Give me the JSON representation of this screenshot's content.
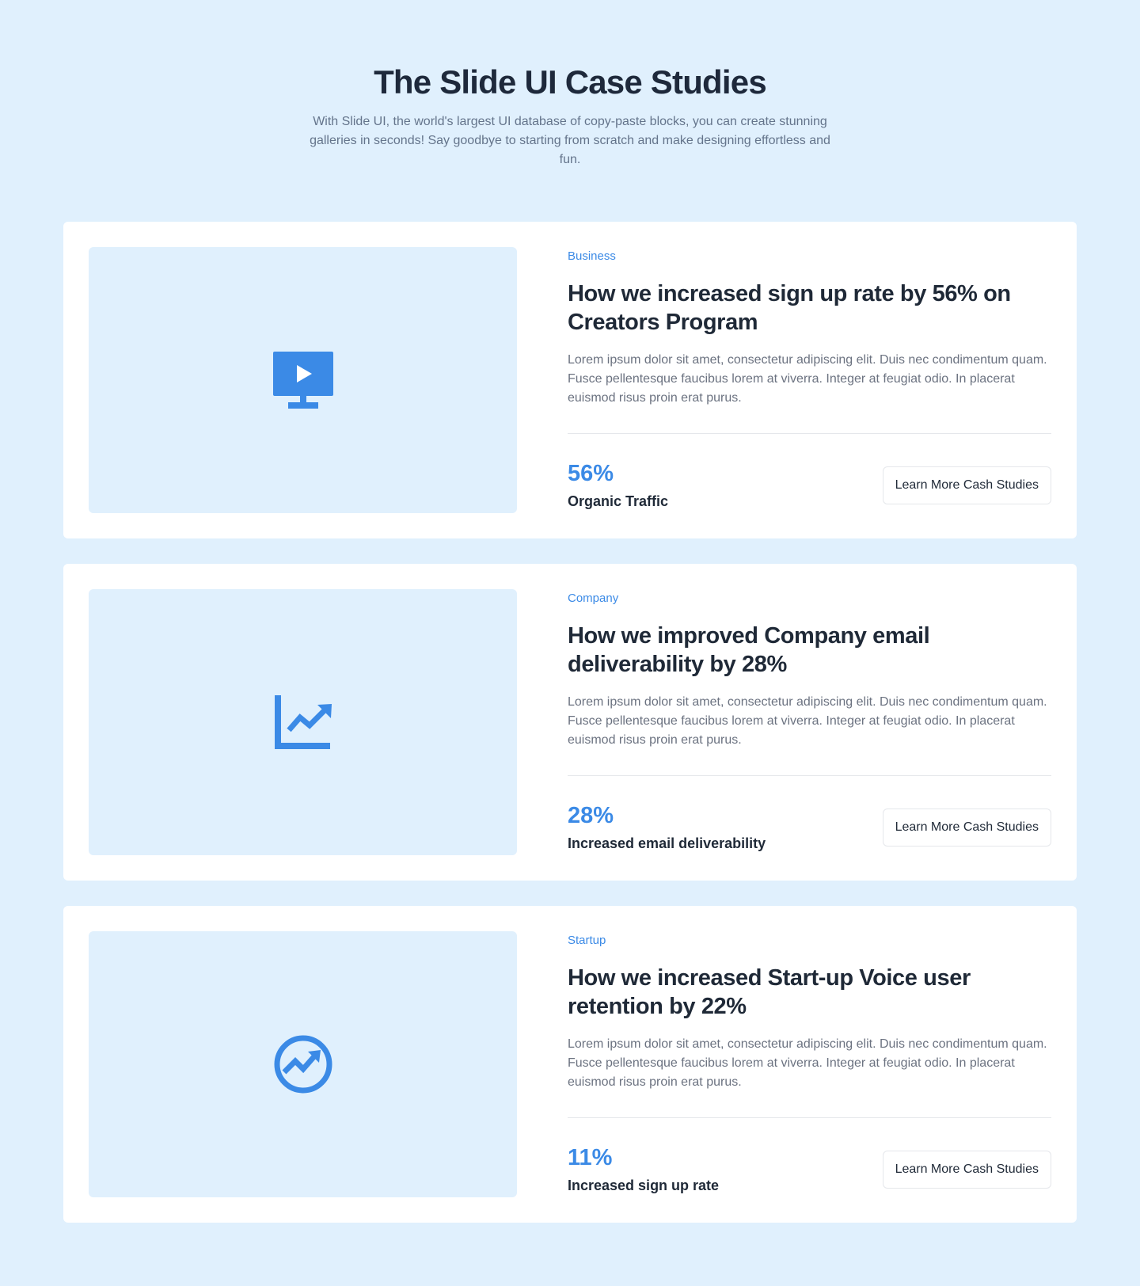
{
  "header": {
    "title": "The Slide UI Case Studies",
    "subtitle": "With Slide UI, the world's largest UI database of copy-paste blocks, you can create stunning galleries in seconds! Say goodbye to starting from scratch and make designing effortless and fun."
  },
  "colors": {
    "page_background": "#e0f0fd",
    "accent": "#3b8ae6",
    "card_background": "#ffffff"
  },
  "cards": [
    {
      "icon": "monitor-play-icon",
      "category": "Business",
      "title": "How we increased sign up rate by 56% on Creators Program",
      "description": "Lorem ipsum dolor sit amet, consectetur adipiscing elit. Duis nec condimentum quam. Fusce pellentesque faucibus lorem at viverra. Integer at feugiat odio. In placerat euismod risus proin erat purus.",
      "stat_value": "56%",
      "stat_label": "Organic Traffic",
      "button_label": "Learn More Cash Studies"
    },
    {
      "icon": "line-chart-icon",
      "category": "Company",
      "title": "How we improved Company email deliverability by 28%",
      "description": "Lorem ipsum dolor sit amet, consectetur adipiscing elit. Duis nec condimentum quam. Fusce pellentesque faucibus lorem at viverra. Integer at feugiat odio. In placerat euismod risus proin erat purus.",
      "stat_value": "28%",
      "stat_label": "Increased email deliverability",
      "button_label": "Learn More Cash Studies"
    },
    {
      "icon": "trending-circle-icon",
      "category": "Startup",
      "title": "How we increased Start-up Voice user retention by 22%",
      "description": "Lorem ipsum dolor sit amet, consectetur adipiscing elit. Duis nec condimentum quam. Fusce pellentesque faucibus lorem at viverra. Integer at feugiat odio. In placerat euismod risus proin erat purus.",
      "stat_value": "11%",
      "stat_label": "Increased sign up rate",
      "button_label": "Learn More Cash Studies"
    }
  ]
}
